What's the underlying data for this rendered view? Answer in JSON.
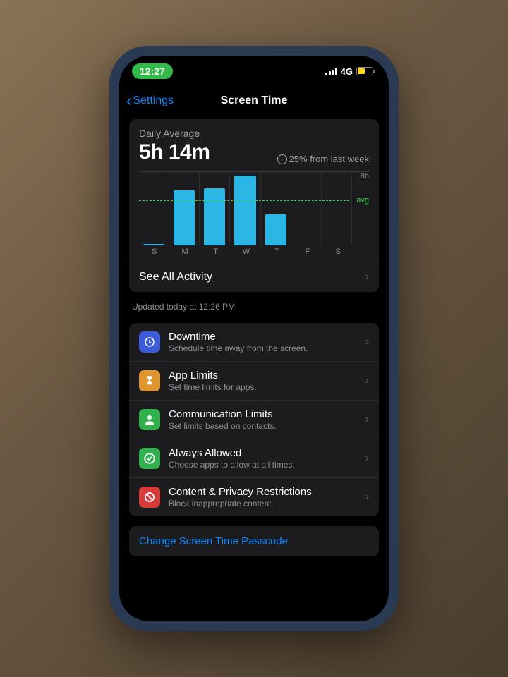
{
  "status": {
    "time": "12:27",
    "network": "4G"
  },
  "nav": {
    "back": "Settings",
    "title": "Screen Time"
  },
  "summary": {
    "label": "Daily Average",
    "value": "5h 14m",
    "trend": "25% from last week",
    "see_all": "See All Activity",
    "updated": "Updated today at 12:26 PM"
  },
  "chart_data": {
    "type": "bar",
    "categories": [
      "S",
      "M",
      "T",
      "W",
      "T",
      "F",
      "S"
    ],
    "values": [
      0.2,
      6.4,
      6.6,
      8.1,
      3.6,
      0,
      0
    ],
    "ylabel_tick": "8h",
    "avg_label": "avg",
    "ylim": [
      0,
      8.5
    ],
    "avg_value": 5.23
  },
  "settings": [
    {
      "title": "Downtime",
      "sub": "Schedule time away from the screen.",
      "icon": "downtime",
      "color": "#3b5bd9"
    },
    {
      "title": "App Limits",
      "sub": "Set time limits for apps.",
      "icon": "hourglass",
      "color": "#e0962e"
    },
    {
      "title": "Communication Limits",
      "sub": "Set limits based on contacts.",
      "icon": "person",
      "color": "#30b14e"
    },
    {
      "title": "Always Allowed",
      "sub": "Choose apps to allow at all times.",
      "icon": "check",
      "color": "#30b14e"
    },
    {
      "title": "Content & Privacy Restrictions",
      "sub": "Block inappropriate content.",
      "icon": "block",
      "color": "#d73a3a"
    }
  ],
  "footer": {
    "change_passcode": "Change Screen Time Passcode"
  }
}
